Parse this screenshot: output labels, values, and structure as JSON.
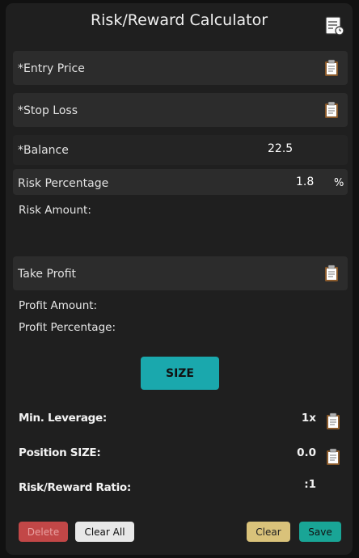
{
  "header": {
    "title": "Risk/Reward Calculator",
    "history_icon": "history-clipboard-icon"
  },
  "fields": {
    "entry_price": {
      "label": "*Entry Price",
      "value": ""
    },
    "stop_loss": {
      "label": "*Stop Loss",
      "value": ""
    },
    "balance": {
      "label": "*Balance",
      "value": "22.5"
    },
    "risk_percentage": {
      "label": "Risk Percentage",
      "value": "1.8",
      "unit": "%"
    },
    "take_profit": {
      "label": "Take Profit",
      "value": ""
    }
  },
  "outputs": {
    "risk_amount": {
      "label": "Risk Amount:"
    },
    "profit_amount": {
      "label": "Profit Amount:"
    },
    "profit_percentage": {
      "label": "Profit Percentage:"
    }
  },
  "size_button": {
    "label": "SIZE"
  },
  "results": {
    "min_leverage": {
      "label": "Min. Leverage:",
      "value": "1x"
    },
    "position_size": {
      "label": "Position SIZE:",
      "value": "0.0"
    },
    "risk_reward": {
      "label": "Risk/Reward Ratio:",
      "value": ":1"
    }
  },
  "footer": {
    "delete": "Delete",
    "clear_all": "Clear All",
    "clear": "Clear",
    "save": "Save"
  },
  "colors": {
    "teal": "#1aa8ad",
    "delete": "#c24747",
    "clear": "#d9c27a",
    "save": "#19a596"
  }
}
